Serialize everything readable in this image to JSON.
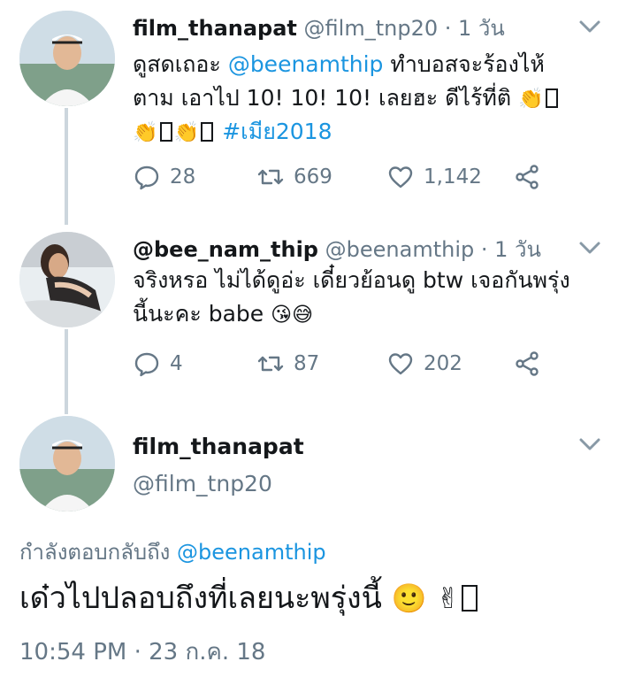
{
  "tweet1": {
    "name": "film_thanapat",
    "handle": "@film_tnp20",
    "time": "· 1 วัน",
    "text_a": "ดูสดเถอะ ",
    "mention": "@beenamthip",
    "text_b": " ทำบอสจะร้องไห้ตาม เอาไป 10! 10! 10! เลยฮะ ดีไร้ที่ติ ",
    "hashtag": "#เมีย2018",
    "replies": "28",
    "retweets": "669",
    "likes": "1,142"
  },
  "tweet2": {
    "name": "@bee_nam_thip",
    "handle": "@beenamthip",
    "time": "· 1 วัน",
    "text": "จริงหรอ ไม่ได้ดูอ่ะ เดี๋ยวย้อนดู btw เจอกันพรุ่งนี้นะคะ babe ",
    "replies": "4",
    "retweets": "87",
    "likes": "202"
  },
  "main_tweet": {
    "name": "film_thanapat",
    "handle": "@film_tnp20",
    "reply_prefix": "กำลังตอบกลับถึง ",
    "reply_to": "@beenamthip",
    "text": "เด๋วไปปลอบถึงที่เลยนะพรุ่งนี้ ",
    "timestamp": "10:54 PM · 23 ก.ค. 18"
  },
  "icons": {
    "reply": "reply-icon",
    "retweet": "retweet-icon",
    "like": "heart-icon",
    "share": "share-icon",
    "menu": "chevron-down-icon"
  },
  "colors": {
    "link": "#1b95e0",
    "secondary": "#657786",
    "thread_line": "#ccd6dd"
  }
}
